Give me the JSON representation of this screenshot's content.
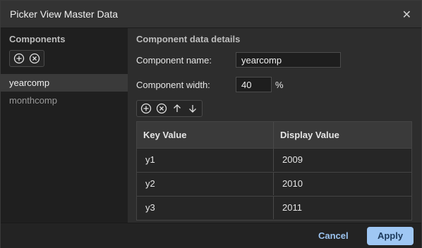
{
  "dialog": {
    "title": "Picker View Master Data",
    "close_icon": "close-icon"
  },
  "sidebar": {
    "title": "Components",
    "icons": [
      "add-circle-icon",
      "remove-circle-icon"
    ],
    "items": [
      {
        "label": "yearcomp",
        "selected": true
      },
      {
        "label": "monthcomp",
        "selected": false
      }
    ]
  },
  "details": {
    "title": "Component data details",
    "name_label": "Component name:",
    "name_value": "yearcomp",
    "width_label": "Component width:",
    "width_value": "40",
    "width_unit": "%",
    "toolbar_icons": [
      "add-circle-icon",
      "remove-circle-icon",
      "arrow-up-icon",
      "arrow-down-icon"
    ]
  },
  "table": {
    "headers": [
      "Key Value",
      "Display Value"
    ],
    "rows": [
      [
        "y1",
        "2009"
      ],
      [
        "y2",
        "2010"
      ],
      [
        "y3",
        "2011"
      ]
    ]
  },
  "footer": {
    "cancel_label": "Cancel",
    "apply_label": "Apply"
  },
  "colors": {
    "accent": "#9fc7f4",
    "cancel_text": "#9cc4f0",
    "background": "#2d2d2d",
    "sidebar": "#1f1f1f"
  }
}
